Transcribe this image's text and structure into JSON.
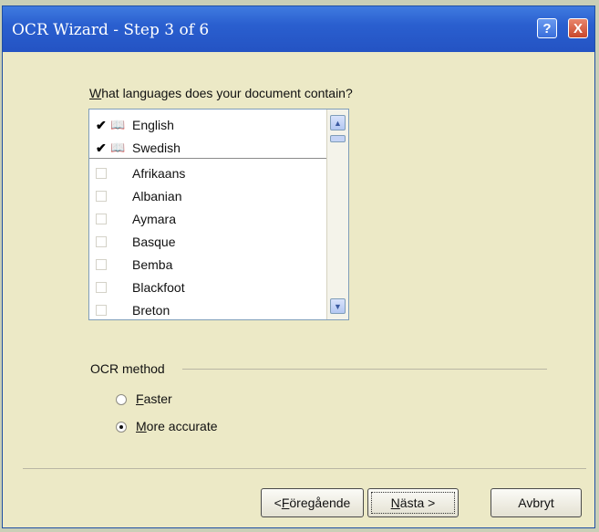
{
  "window": {
    "title": "OCR Wizard - Step 3 of 6",
    "help_icon": "?",
    "close_icon": "X"
  },
  "languages": {
    "question_accel": "W",
    "question_rest": "hat languages does your document contain?",
    "selected": [
      {
        "label": "English",
        "checked": true
      },
      {
        "label": "Swedish",
        "checked": true
      }
    ],
    "available": [
      {
        "label": "Afrikaans",
        "checked": false
      },
      {
        "label": "Albanian",
        "checked": false
      },
      {
        "label": "Aymara",
        "checked": false
      },
      {
        "label": "Basque",
        "checked": false
      },
      {
        "label": "Bemba",
        "checked": false
      },
      {
        "label": "Blackfoot",
        "checked": false
      },
      {
        "label": "Breton",
        "checked": false
      }
    ]
  },
  "ocr_method": {
    "label": "OCR method",
    "options": [
      {
        "accel": "F",
        "rest": "aster",
        "selected": false
      },
      {
        "accel": "M",
        "rest": "ore accurate",
        "selected": true
      }
    ]
  },
  "buttons": {
    "back_prefix": "< ",
    "back_accel": "F",
    "back_rest": "öregående",
    "next_accel": "N",
    "next_rest": "ästa >",
    "cancel": "Avbryt"
  }
}
